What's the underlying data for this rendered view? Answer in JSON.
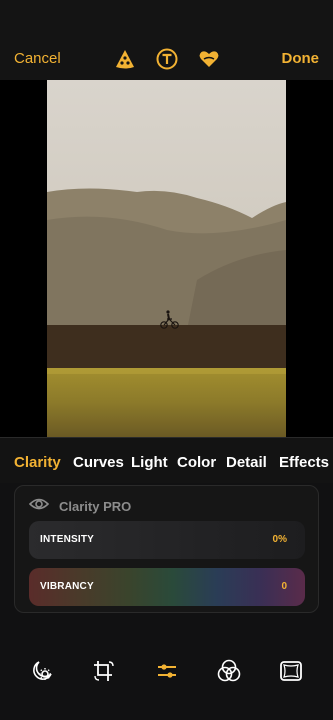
{
  "header": {
    "cancel_label": "Cancel",
    "done_label": "Done",
    "icons": [
      "pizza-icon",
      "text-t-icon",
      "heart-icon"
    ]
  },
  "tabs": [
    {
      "label": "Clarity",
      "active": true
    },
    {
      "label": "Curves",
      "active": false
    },
    {
      "label": "Light",
      "active": false
    },
    {
      "label": "Color",
      "active": false
    },
    {
      "label": "Detail",
      "active": false
    },
    {
      "label": "Effects",
      "active": false
    }
  ],
  "panel": {
    "title": "Clarity PRO",
    "intensity": {
      "label": "INTENSITY",
      "value": "0%"
    },
    "vibrancy": {
      "label": "VIBRANCY",
      "value": "0"
    }
  },
  "toolbar": {
    "icons": [
      "sun-moon-icon",
      "crop-rotate-icon",
      "adjust-sliders-icon",
      "color-circles-icon",
      "frame-icon"
    ],
    "active": "adjust-sliders-icon"
  },
  "colors": {
    "accent": "#f2b233",
    "background": "#111112"
  }
}
